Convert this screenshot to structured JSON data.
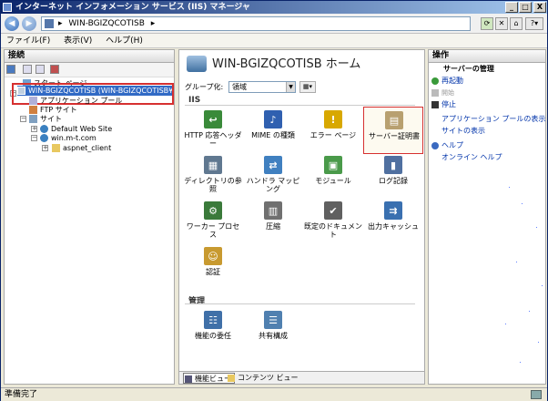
{
  "window": {
    "title": "インターネット インフォメーション サービス (IIS) マネージャ",
    "controls": {
      "minimize": "_",
      "maximize": "□",
      "close": "X"
    }
  },
  "address": {
    "path": "WIN-BGIZQCOTISB",
    "separator": "▸"
  },
  "menu": {
    "file": "ファイル(F)",
    "view": "表示(V)",
    "help": "ヘルプ(H)"
  },
  "connections": {
    "header": "接続",
    "tree": {
      "start_page": "スタート ページ",
      "server": "WIN-BGIZQCOTISB (WIN-BGIZQCOTISB¥Admi",
      "app_pools": "アプリケーション プール",
      "ftp_sites": "FTP サイト",
      "sites": "サイト",
      "default_site": "Default Web Site",
      "win_site": "win.m-t.com",
      "aspnet_client": "aspnet_client"
    }
  },
  "main": {
    "title": "WIN-BGIZQCOTISB ホーム",
    "group_by_label": "グループ化:",
    "group_by_value": "領域",
    "section_iis": "IIS",
    "section_manage": "管理",
    "features": [
      {
        "label": "HTTP 応答ヘッダー",
        "icon": "http-headers-icon",
        "color": "#3a8a3a",
        "glyph": "↩"
      },
      {
        "label": "MIME の種類",
        "icon": "mime-types-icon",
        "color": "#3060b0",
        "glyph": "♪"
      },
      {
        "label": "エラー ページ",
        "icon": "error-pages-icon",
        "color": "#d8a800",
        "glyph": "!"
      },
      {
        "label": "サーバー証明書",
        "icon": "server-certificates-icon",
        "color": "#b8a070",
        "glyph": "▤"
      },
      {
        "label": "ディレクトリの参照",
        "icon": "directory-browsing-icon",
        "color": "#607890",
        "glyph": "▦"
      },
      {
        "label": "ハンドラ マッピング",
        "icon": "handler-mappings-icon",
        "color": "#4080c0",
        "glyph": "⇄"
      },
      {
        "label": "モジュール",
        "icon": "modules-icon",
        "color": "#4a9a4a",
        "glyph": "▣"
      },
      {
        "label": "ログ記録",
        "icon": "logging-icon",
        "color": "#5070a0",
        "glyph": "▮"
      },
      {
        "label": "ワーカー プロセス",
        "icon": "worker-processes-icon",
        "color": "#3a7a3a",
        "glyph": "⚙"
      },
      {
        "label": "圧縮",
        "icon": "compression-icon",
        "color": "#707070",
        "glyph": "▥"
      },
      {
        "label": "既定のドキュメント",
        "icon": "default-document-icon",
        "color": "#606060",
        "glyph": "✔"
      },
      {
        "label": "出力キャッシュ",
        "icon": "output-cache-icon",
        "color": "#3a70b0",
        "glyph": "⇉"
      },
      {
        "label": "認証",
        "icon": "authentication-icon",
        "color": "#c89a30",
        "glyph": "☺"
      }
    ],
    "manage_features": [
      {
        "label": "機能の委任",
        "icon": "feature-delegation-icon",
        "color": "#4070a8",
        "glyph": "☷"
      },
      {
        "label": "共有構成",
        "icon": "shared-config-icon",
        "color": "#5080b0",
        "glyph": "☰"
      }
    ],
    "tabs": {
      "features_view": "機能ビュー",
      "content_view": "コンテンツ ビュー"
    }
  },
  "actions": {
    "header": "操作",
    "manage_server": "サーバーの管理",
    "restart": "再起動",
    "start": "開始",
    "stop": "停止",
    "view_app_pools": "アプリケーション プールの表示",
    "view_sites": "サイトの表示",
    "help": "ヘルプ",
    "online_help": "オンライン ヘルプ"
  },
  "status": {
    "text": "準備完了"
  }
}
